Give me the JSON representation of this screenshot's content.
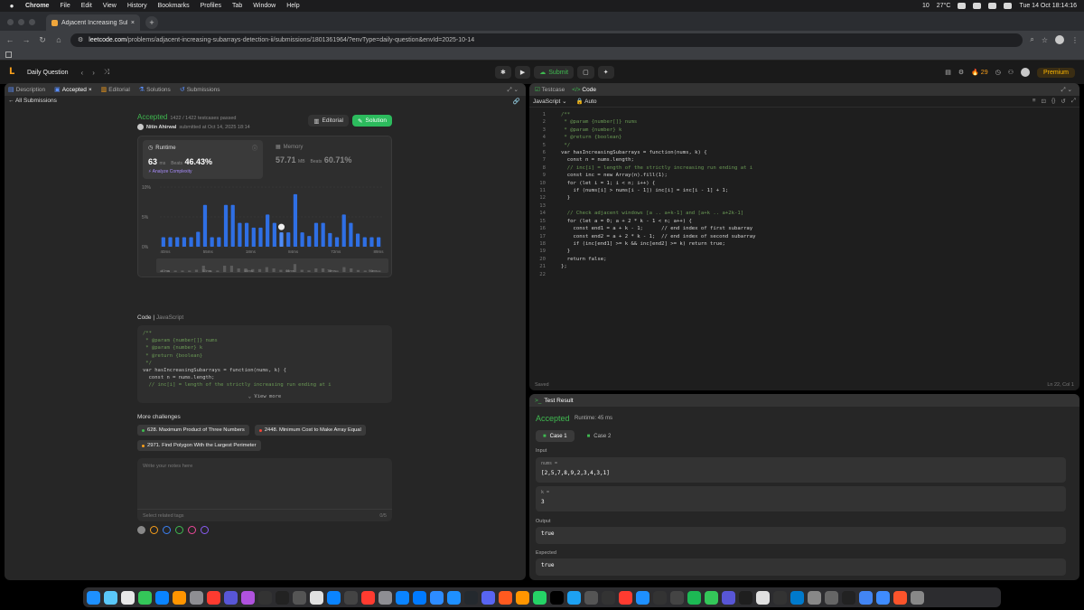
{
  "menubar": {
    "app": "Chrome",
    "menus": [
      "File",
      "Edit",
      "View",
      "History",
      "Bookmarks",
      "Profiles",
      "Tab",
      "Window",
      "Help"
    ],
    "temperature": "27°C",
    "battery_text": "10",
    "datetime": "Tue 14 Oct 18:14:16"
  },
  "browser": {
    "tab_title": "Adjacent Increasing Subarrays",
    "url_host": "leetcode.com",
    "url_path": "/problems/adjacent-increasing-subarrays-detection-ii/submissions/1801361964/?envType=daily-question&envId=2025-10-14"
  },
  "lc_header": {
    "daily_question": "Daily Question",
    "submit_label": "Submit",
    "streak": "29",
    "premium": "Premium"
  },
  "left_tabs": [
    "Description",
    "Accepted",
    "Editorial",
    "Solutions",
    "Submissions"
  ],
  "all_submissions": "All Submissions",
  "submission": {
    "status": "Accepted",
    "passed": "1422 / 1422 testcases passed",
    "user": "Nitin Ahirwal",
    "submitted": "submitted at Oct 14, 2025 18:14",
    "editorial_btn": "Editorial",
    "solution_btn": "Solution",
    "runtime_label": "Runtime",
    "runtime_value": "63",
    "runtime_unit": "ms",
    "runtime_beats_label": "Beats",
    "runtime_beats": "46.43%",
    "analyze": "Analyze Complexity",
    "memory_label": "Memory",
    "memory_value": "57.71",
    "memory_unit": "MB",
    "memory_beats_label": "Beats",
    "memory_beats": "60.71%"
  },
  "chart_data": {
    "type": "bar",
    "title": "",
    "ylabel": "",
    "y_ticks": [
      "10%",
      "5%",
      "0%"
    ],
    "ylim": [
      0,
      10
    ],
    "x_tick_labels": [
      "40ms",
      "55ms",
      "18ms",
      "84ms",
      "72ms",
      "89ms"
    ],
    "mini_tick_labels": [
      "40ms",
      "53ms",
      "58ms",
      "64ms",
      "79ms",
      "99ms"
    ],
    "values": [
      1.6,
      1.6,
      1.6,
      1.6,
      1.6,
      2.5,
      7.0,
      1.6,
      1.6,
      7.0,
      7.0,
      4.0,
      4.0,
      3.2,
      3.2,
      5.4,
      4.0,
      2.4,
      2.4,
      8.8,
      2.4,
      1.8,
      4.0,
      4.0,
      2.3,
      1.6,
      5.4,
      4.0,
      2.2,
      1.6,
      1.6,
      1.6
    ],
    "highlight_index": 17,
    "bar_color": "#2f6fe4",
    "highlight_color": "#4f8cf7"
  },
  "code_section": {
    "label": "Code",
    "language": "JavaScript",
    "view_more": "View more",
    "preview_lines": [
      "/**",
      " * @param {number[]} nums",
      " * @param {number} k",
      " * @return {boolean}",
      " */",
      "var hasIncreasingSubarrays = function(nums, k) {",
      "  const n = nums.length;",
      "  // inc[i] = length of the strictly increasing run ending at i"
    ]
  },
  "more_challenges": {
    "title": "More challenges",
    "items": [
      {
        "label": "628. Maximum Product of Three Numbers",
        "color": "#3fb950"
      },
      {
        "label": "2448. Minimum Cost to Make Array Equal",
        "color": "#f44336"
      },
      {
        "label": "2971. Find Polygon With the Largest Perimeter",
        "color": "#f89f1b"
      }
    ]
  },
  "notes": {
    "placeholder": "Write your notes here",
    "tags_placeholder": "Select related tags",
    "counter": "0/5"
  },
  "editor": {
    "tabs": [
      "Testcase",
      "Code"
    ],
    "language": "JavaScript",
    "auto": "Auto",
    "saved": "Saved",
    "position": "Ln 22, Col 1",
    "lines": [
      "/**",
      " * @param {number[]} nums",
      " * @param {number} k",
      " * @return {boolean}",
      " */",
      "var hasIncreasingSubarrays = function(nums, k) {",
      "  const n = nums.length;",
      "  // inc[i] = length of the strictly increasing run ending at i",
      "  const inc = new Array(n).fill(1);",
      "  for (let i = 1; i < n; i++) {",
      "    if (nums[i] > nums[i - 1]) inc[i] = inc[i - 1] + 1;",
      "  }",
      "",
      "  // Check adjacent windows [a .. a+k-1] and [a+k .. a+2k-1]",
      "  for (let a = 0; a + 2 * k - 1 < n; a++) {",
      "    const end1 = a + k - 1;      // end index of first subarray",
      "    const end2 = a + 2 * k - 1;  // end index of second subarray",
      "    if (inc[end1] >= k && inc[end2] >= k) return true;",
      "  }",
      "  return false;",
      "};",
      ""
    ]
  },
  "test_result": {
    "tab": "Test Result",
    "status": "Accepted",
    "runtime": "Runtime: 45 ms",
    "cases": [
      "Case 1",
      "Case 2"
    ],
    "input_label": "Input",
    "var1_name": "nums =",
    "var1_value": "[2,5,7,8,9,2,3,4,3,1]",
    "var2_name": "k =",
    "var2_value": "3",
    "output_label": "Output",
    "output_value": "true",
    "expected_label": "Expected",
    "expected_value": "true"
  },
  "dock_colors": [
    "#1e90ff",
    "#5ac8fa",
    "#e8e8e8",
    "#34c759",
    "#0a84ff",
    "#ff9500",
    "#8e8e93",
    "#ff3b30",
    "#5856d6",
    "#af52de",
    "#333",
    "#222",
    "#555",
    "#e0e0e0",
    "#0a84ff",
    "#444",
    "#ff3b30",
    "#8e8e93",
    "#0a84ff",
    "#007aff",
    "#2d8cff",
    "#1e90ff",
    "#24292e",
    "#5865f2",
    "#ff5a1f",
    "#ff9500",
    "#25d366",
    "#000",
    "#1da1f2",
    "#555",
    "#333",
    "#ff3b30",
    "#1e90ff",
    "#333",
    "#444",
    "#1db954",
    "#34c759",
    "#5856d6",
    "#1e1e1e",
    "#e0e0e0",
    "#333",
    "#007acc",
    "#888",
    "#666",
    "#222",
    "#4285f4",
    "#3f8cff",
    "#fb542b",
    "#888"
  ]
}
